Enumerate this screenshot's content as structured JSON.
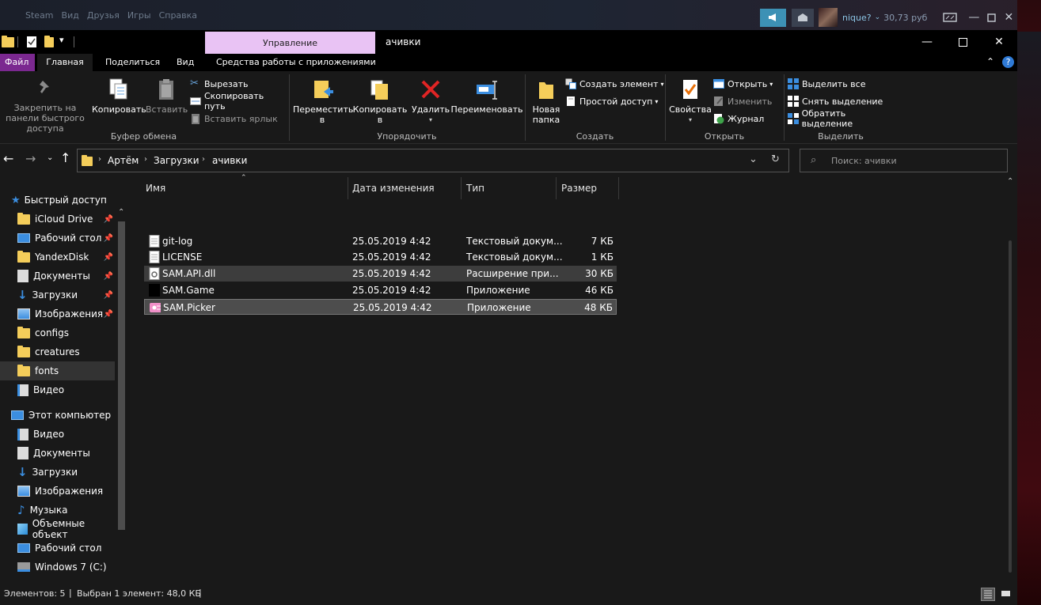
{
  "steam": {
    "menu": [
      "Steam",
      "Вид",
      "Друзья",
      "Игры",
      "Справка"
    ],
    "user": "nique?",
    "balance": "30,73 руб"
  },
  "window": {
    "title": "ачивки",
    "context_tab": "Управление",
    "context_tools": "Средства работы с приложениями"
  },
  "tabs": {
    "file": "Файл",
    "home": "Главная",
    "share": "Поделиться",
    "view": "Вид"
  },
  "ribbon": {
    "clipboard": {
      "pin": "Закрепить на панели быстрого доступа",
      "copy": "Копировать",
      "paste": "Вставить",
      "cut": "Вырезать",
      "copy_path": "Скопировать путь",
      "paste_shortcut": "Вставить ярлык",
      "label": "Буфер обмена"
    },
    "organize": {
      "move": "Переместить в",
      "copy_to": "Копировать в",
      "delete": "Удалить",
      "rename": "Переименовать",
      "label": "Упорядочить"
    },
    "create": {
      "new_folder": "Новая папка",
      "new_item": "Создать элемент",
      "easy_access": "Простой доступ",
      "label": "Создать"
    },
    "open": {
      "properties": "Свойства",
      "open": "Открыть",
      "edit": "Изменить",
      "history": "Журнал",
      "label": "Открыть"
    },
    "select": {
      "select_all": "Выделить все",
      "select_none": "Снять выделение",
      "invert": "Обратить выделение",
      "label": "Выделить"
    }
  },
  "address": {
    "crumbs": [
      "Артём",
      "Загрузки",
      "ачивки"
    ],
    "search_placeholder": "Поиск: ачивки"
  },
  "nav": {
    "quick_access": "Быстрый доступ",
    "quick_items": [
      "iCloud Drive",
      "Рабочий стол",
      "YandexDisk",
      "Документы",
      "Загрузки",
      "Изображения",
      "configs",
      "creatures",
      "fonts",
      "Видео"
    ],
    "this_pc": "Этот компьютер",
    "pc_items": [
      "Видео",
      "Документы",
      "Загрузки",
      "Изображения",
      "Музыка",
      "Объемные объект",
      "Рабочий стол",
      "Windows 7 (C:)"
    ]
  },
  "columns": [
    "Имя",
    "Дата изменения",
    "Тип",
    "Размер"
  ],
  "files": [
    {
      "name": "git-log",
      "date": "25.05.2019 4:42",
      "type": "Текстовый докум...",
      "size": "7 КБ"
    },
    {
      "name": "LICENSE",
      "date": "25.05.2019 4:42",
      "type": "Текстовый докум...",
      "size": "1 КБ"
    },
    {
      "name": "SAM.API.dll",
      "date": "25.05.2019 4:42",
      "type": "Расширение при...",
      "size": "30 КБ"
    },
    {
      "name": "SAM.Game",
      "date": "25.05.2019 4:42",
      "type": "Приложение",
      "size": "46 КБ"
    },
    {
      "name": "SAM.Picker",
      "date": "25.05.2019 4:42",
      "type": "Приложение",
      "size": "48 КБ"
    }
  ],
  "status": {
    "count": "Элементов: 5",
    "selected": "Выбран 1 элемент: 48,0 КБ"
  }
}
